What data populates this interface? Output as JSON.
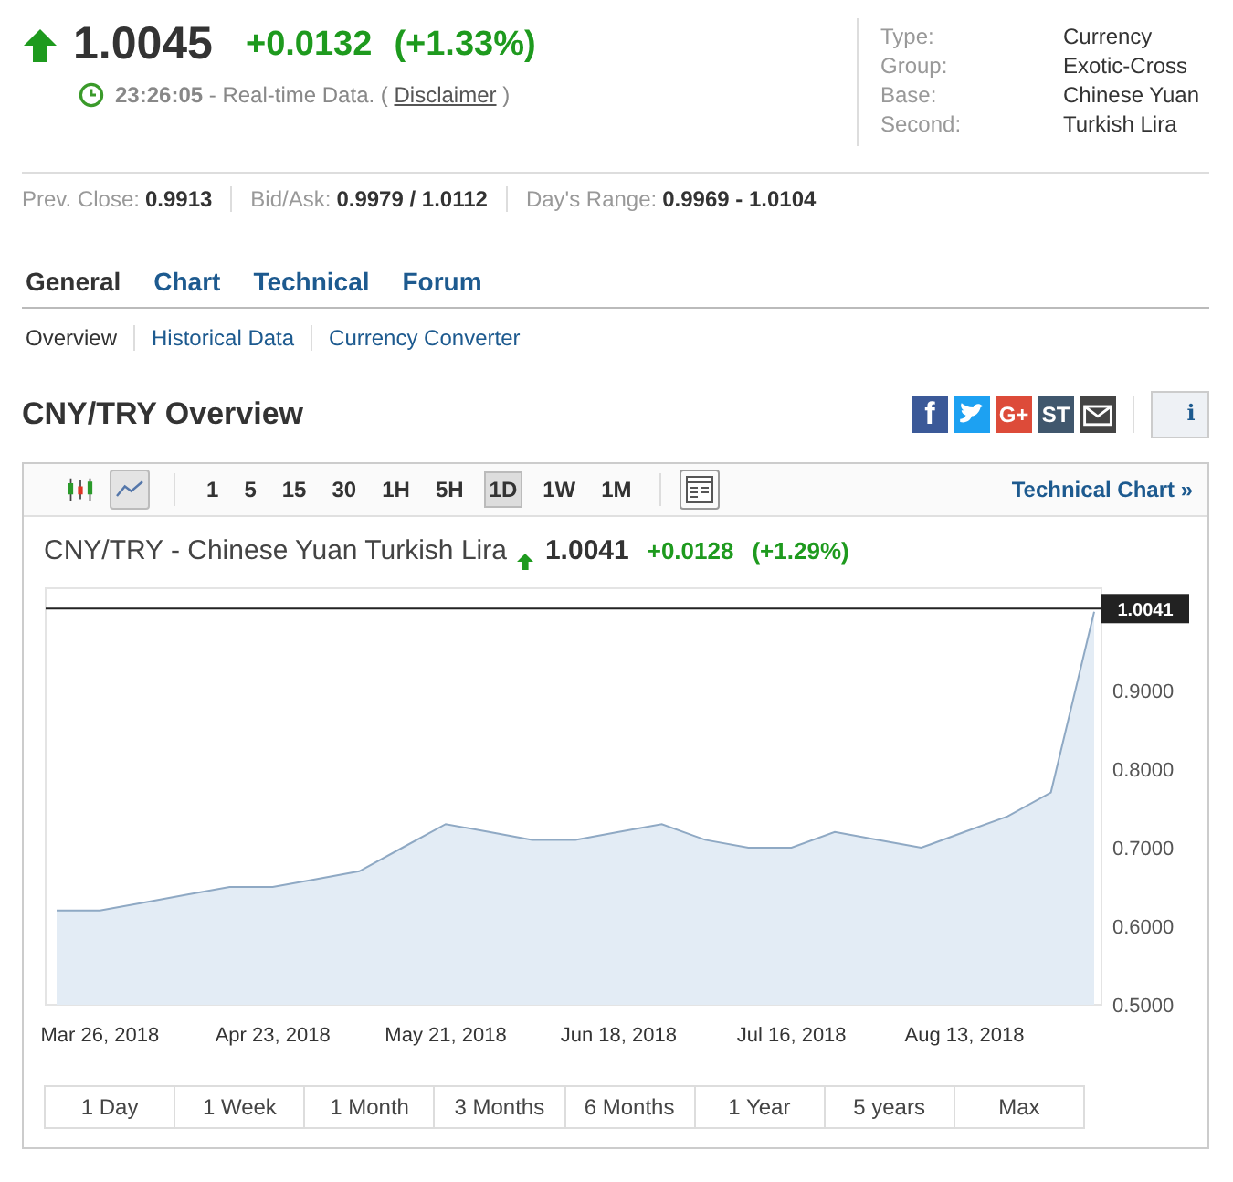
{
  "quote": {
    "price": "1.0045",
    "change": "+0.0132",
    "change_pct": "(+1.33%)",
    "time_note": "**23:26:05** - Real-time Data. (",
    "disclaimer": "Disclaimer",
    "note_end": ")"
  },
  "info": [
    {
      "label": "Type:",
      "value": "Currency"
    },
    {
      "label": "Group:",
      "value": "Exotic-Cross"
    },
    {
      "label": "Base:",
      "value": "Chinese Yuan"
    },
    {
      "label": "Second:",
      "value": "Turkish Lira"
    }
  ],
  "stats": [
    {
      "label": "Prev. Close:",
      "value": "0.9913"
    },
    {
      "label": "Bid/Ask:",
      "value": "0.9979 / 1.0112"
    },
    {
      "label": "Day's Range:",
      "value": "0.9969 - 1.0104"
    }
  ],
  "tabs": [
    {
      "label": "General",
      "selected": true
    },
    {
      "label": "Chart",
      "selected": false
    },
    {
      "label": "Technical",
      "selected": false
    },
    {
      "label": "Forum",
      "selected": false
    }
  ],
  "subtabs": [
    {
      "label": "Overview",
      "selected": true
    },
    {
      "label": "Historical Data",
      "selected": false
    },
    {
      "label": "Currency Converter",
      "selected": false
    }
  ],
  "section_title": "CNY/TRY Overview",
  "share": [
    {
      "kind": "facebook",
      "label": "f"
    },
    {
      "kind": "twitter"
    },
    {
      "kind": "google",
      "label": "G+"
    },
    {
      "kind": "stocktwits",
      "label": "ST"
    },
    {
      "kind": "email"
    },
    {
      "kind": "info",
      "label": "i"
    }
  ],
  "chart_panel": {
    "chart_types": [
      {
        "kind": "candlestick",
        "selected": false
      },
      {
        "kind": "line",
        "selected": true
      }
    ],
    "intervals": [
      {
        "label": "1",
        "selected": false
      },
      {
        "label": "5",
        "selected": false
      },
      {
        "label": "15",
        "selected": false
      },
      {
        "label": "30",
        "selected": false
      },
      {
        "label": "1H",
        "selected": false
      },
      {
        "label": "5H",
        "selected": false
      },
      {
        "label": "1D",
        "selected": true
      },
      {
        "label": "1W",
        "selected": false
      },
      {
        "label": "1M",
        "selected": false
      }
    ],
    "technical_link": "Technical Chart »",
    "title": "CNY/TRY - Chinese Yuan Turkish Lira",
    "price": "1.0041",
    "change": "+0.0128",
    "change_pct": "(+1.29%)",
    "chart_data": {
      "type": "area",
      "categories": [
        null,
        "Mar 26, 2018",
        null,
        null,
        null,
        "Apr 23, 2018",
        null,
        null,
        null,
        "May 21, 2018",
        null,
        null,
        null,
        "Jun 18, 2018",
        null,
        null,
        null,
        "Jul 16, 2018",
        null,
        null,
        null,
        "Aug 13, 2018",
        null,
        null,
        null
      ],
      "series": [
        {
          "color": "#8fa9c4",
          "values": [
            0.62,
            0.62,
            0.63,
            0.64,
            0.65,
            0.65,
            0.66,
            0.67,
            0.7,
            0.73,
            0.72,
            0.71,
            0.71,
            0.72,
            0.73,
            0.71,
            0.7,
            0.7,
            0.72,
            0.71,
            0.7,
            0.72,
            0.74,
            0.77,
            1.0
          ]
        }
      ],
      "ylim": [
        0.5,
        1.03
      ],
      "yticks": [
        {
          "value": 0.5,
          "label": "0.5000"
        },
        {
          "value": 0.6,
          "label": "0.6000"
        },
        {
          "value": 0.7,
          "label": "0.7000"
        },
        {
          "value": 0.8,
          "label": "0.8000"
        },
        {
          "value": 0.9,
          "label": "0.9000"
        }
      ],
      "ref_lines": [
        {
          "axis": "y",
          "value": 1.0041,
          "label": "1.0041",
          "color": "#222222"
        }
      ]
    },
    "periods": [
      {
        "label": "1 Day",
        "selected": false
      },
      {
        "label": "1 Week",
        "selected": false
      },
      {
        "label": "1 Month",
        "selected": false
      },
      {
        "label": "3 Months",
        "selected": false
      },
      {
        "label": "6 Months",
        "selected": false
      },
      {
        "label": "1 Year",
        "selected": false
      },
      {
        "label": "5 years",
        "selected": false
      },
      {
        "label": "Max",
        "selected": false
      }
    ]
  }
}
